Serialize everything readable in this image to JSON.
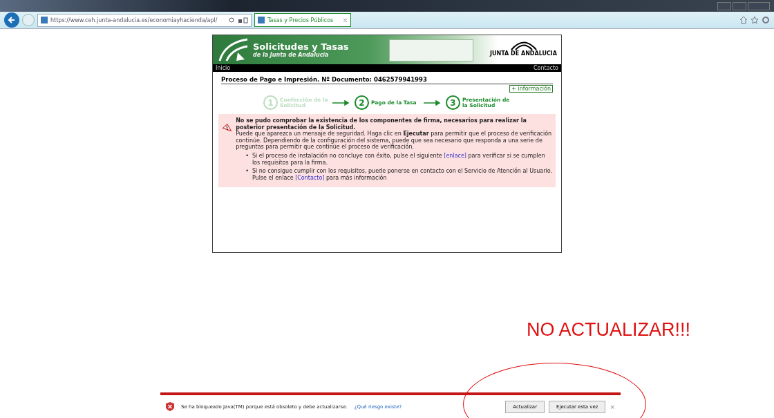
{
  "browser": {
    "url": "https://www.ceh.junta-andalucia.es/economiayhacienda/apl/",
    "tab": {
      "title": "Tasas y Precios Públicos",
      "selected": true
    }
  },
  "site": {
    "title": "Solicitudes y Tasas",
    "subtitle": "de la Junta de Andalucía",
    "logo_text": "JUNTA DE ANDALUCIA",
    "nav": [
      "Inicio",
      "Contacto"
    ]
  },
  "page": {
    "heading": "Proceso de Pago e Impresión. Nº Documento: 0462579941993",
    "info_link": "+ información",
    "steps": [
      {
        "number": "1",
        "label": "Confección de la Solicitud",
        "active": false
      },
      {
        "number": "2",
        "label": "Pago de la Tasa",
        "active": true
      },
      {
        "number": "3",
        "label": "Presentación de la Solicitud",
        "active": true
      }
    ],
    "alert": {
      "title": "No se pudo comprobar la existencia de los componentes de firma, necesarios para realizar la posterior presentación de la Solicitud.",
      "body": "Puede que aparezca un mensaje de seguridad. Haga clic en **Ejecutar** para permitir que el proceso de verificación continúe. Dependiendo de la configuración del sistema, puede que sea necesario que responda a una serie de preguntas para permitir que continúe el proceso de verificación.",
      "bullets": [
        {
          "marker": "•",
          "before": "Si el proceso de instalación no concluye con éxito, pulse el siguiente",
          "link": "[enlace]",
          "after": "para verificar si se cumplen los requisitos para la firma."
        },
        {
          "marker": "•",
          "before": "Si no consigue cumplir con los requisitos, puede ponerse en contacto con el Servicio de Atención al Usuario. Pulse el enlace",
          "link": "[Contacto]",
          "after": "para más información"
        }
      ]
    }
  },
  "annotation": "NO ACTUALIZAR!!!",
  "notification": {
    "message": "Se ha bloqueado Java(TM) porque está obsoleto y debe actualizarse.",
    "link": "¿Qué riesgo existe?",
    "buttons": [
      "Actualizar",
      "Ejecutar esta vez"
    ],
    "close": "×"
  }
}
